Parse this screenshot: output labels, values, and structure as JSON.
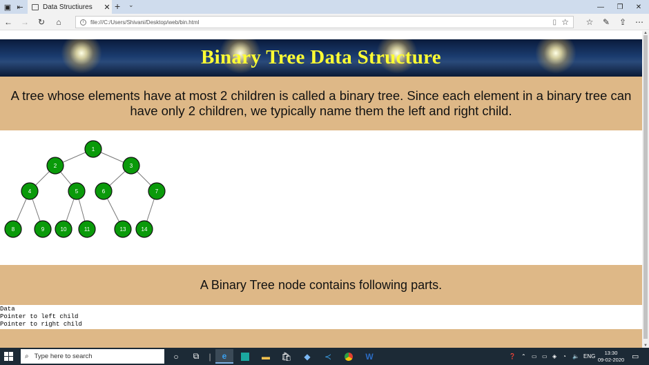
{
  "browser": {
    "tab_title": "Data Structiures",
    "tab_close": "✕",
    "new_tab": "+",
    "tab_menu": "⌄",
    "window_controls": {
      "minimize": "—",
      "restore": "❐",
      "close": "✕"
    },
    "address": "file:///C:/Users/Shivani/Desktop/web/bin.html"
  },
  "page": {
    "banner_title": "Binary Tree Data Structure",
    "intro": "A tree whose elements have at most 2 children is called a binary tree. Since each element in a binary tree can have only 2 children, we typically name them the left and right child.",
    "tree": {
      "node_color": "#0a9a0a",
      "nodes": [
        "1",
        "2",
        "3",
        "4",
        "5",
        "6",
        "7",
        "8",
        "9",
        "10",
        "11",
        "13",
        "14"
      ]
    },
    "parts_heading": "A Binary Tree node contains following parts.",
    "parts_list": [
      "Data",
      "Pointer to left child",
      "Pointer to right child"
    ]
  },
  "taskbar": {
    "search_placeholder": "Type here to search",
    "language": "ENG",
    "time": "13:30",
    "date": "09-02-2020"
  },
  "colors": {
    "band": "#deb887",
    "banner_title": "#ffff33",
    "taskbar": "#1c2a36"
  }
}
